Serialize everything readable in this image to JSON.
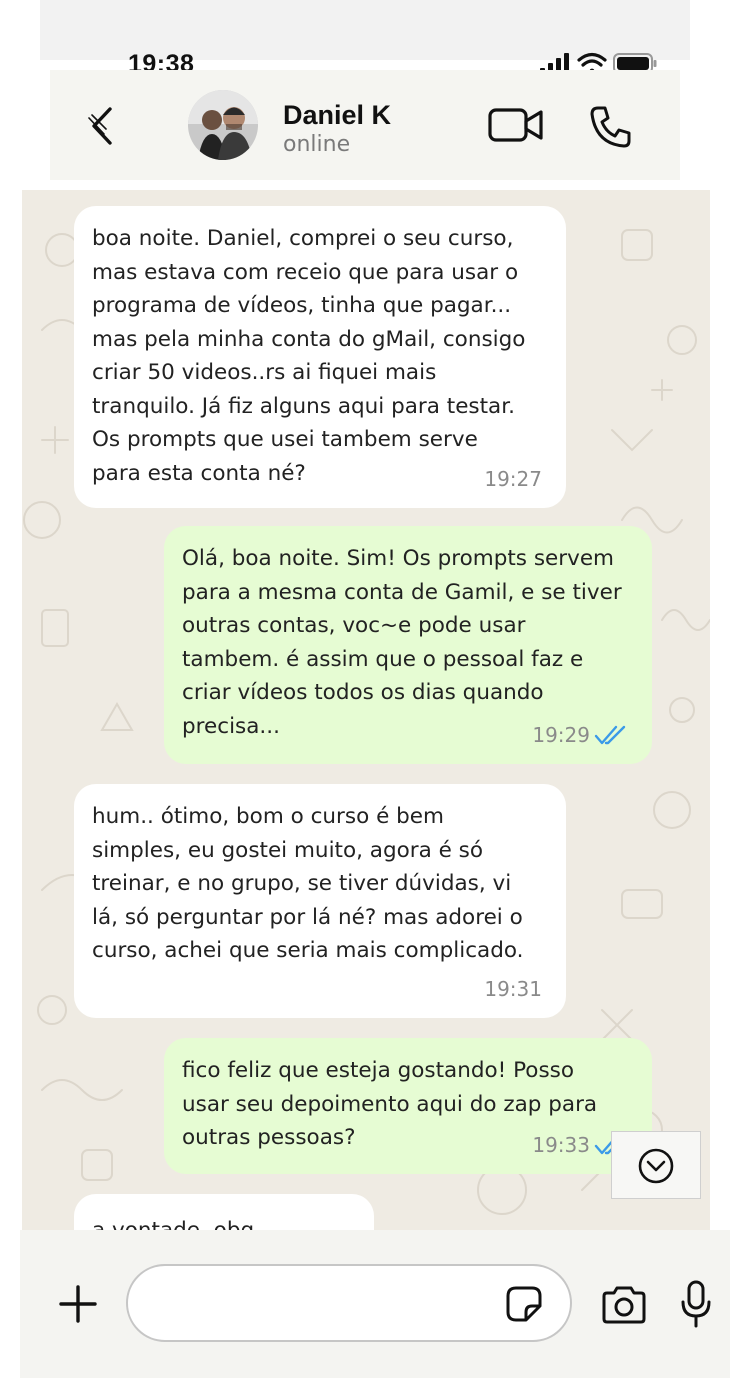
{
  "status_bar": {
    "time": "19:38",
    "icons": [
      "signal-icon",
      "wifi-icon",
      "battery-icon"
    ]
  },
  "header": {
    "contact_name": "Daniel K",
    "contact_status": "online",
    "icons": [
      "back-arrow-icon",
      "video-call-icon",
      "phone-call-icon"
    ]
  },
  "messages": [
    {
      "direction": "incoming",
      "text": "boa noite. Daniel, comprei o seu curso,\nmas estava com receio que para usar o\nprograma de vídeos, tinha que pagar...\nmas pela minha conta do gMail, consigo\ncriar 50 videos..rs ai fiquei mais\ntranquilo. Já fiz alguns aqui para testar.\nOs prompts que usei tambem serve\npara esta conta né?",
      "time": "19:27"
    },
    {
      "direction": "outgoing",
      "text": "Olá, boa noite. Sim! Os prompts servem\npara a mesma conta de Gamil, e se tiver\noutras contas, voc~e pode usar\ntambem. é assim que o pessoal faz e\ncriar vídeos todos os dias quando\nprecisa...",
      "time": "19:29",
      "read": true
    },
    {
      "direction": "incoming",
      "text": "hum.. ótimo, bom o curso é bem\nsimples, eu gostei muito, agora é só\ntreinar, e no grupo, se tiver dúvidas, vi\nlá, só perguntar por lá né? mas adorei o\ncurso, achei que seria mais complicado.",
      "time": "19:31"
    },
    {
      "direction": "outgoing",
      "text": "fico feliz que esteja gostando! Posso\nusar seu depoimento aqui do zap para\noutras pessoas?",
      "time": "19:33",
      "read": true
    },
    {
      "direction": "incoming",
      "text": "a vontade, obg"
    }
  ],
  "composer": {
    "input_value": "",
    "icons": [
      "plus-icon",
      "sticker-icon",
      "camera-icon",
      "microphone-icon"
    ]
  },
  "colors": {
    "incoming_bubble": "#ffffff",
    "outgoing_bubble": "#e6fcd3",
    "chat_background": "#efebe3",
    "read_ticks": "#3b9ae8",
    "header_background": "#f5f5f1"
  }
}
